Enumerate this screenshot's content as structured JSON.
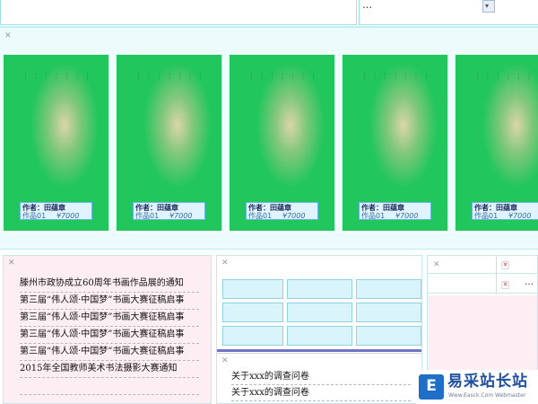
{
  "top": {
    "notice_text": "…",
    "scroll_icon": "chevron-down-icon"
  },
  "gallery": {
    "close_icon": "close-icon",
    "cards": [
      {
        "author": "作者：田蕴章",
        "work": "作品01",
        "price": "¥7000",
        "calligraphy": [
          "…",
          "…",
          "…",
          "…",
          "…",
          "…",
          "…"
        ]
      },
      {
        "author": "作者：田蕴章",
        "work": "作品01",
        "price": "¥7000",
        "calligraphy": [
          "…",
          "…",
          "…",
          "…",
          "…",
          "…",
          "…"
        ]
      },
      {
        "author": "作者：田蕴章",
        "work": "作品01",
        "price": "¥7000",
        "calligraphy": [
          "…",
          "…",
          "…",
          "…",
          "…",
          "…",
          "…"
        ]
      },
      {
        "author": "作者：田蕴章",
        "work": "作品01",
        "price": "¥7000",
        "calligraphy": [
          "…",
          "…",
          "…",
          "…",
          "…",
          "…",
          "…"
        ]
      },
      {
        "author": "作者：田蕴章",
        "work": "作品01",
        "price": "¥7000",
        "calligraphy": [
          "…",
          "…",
          "…",
          "…",
          "…",
          "…",
          "…"
        ]
      }
    ]
  },
  "news": {
    "items": [
      "滕州市政协成立60周年书画作品展的通知",
      "第三届“伟人颂·中国梦”书画大赛征稿启事",
      "第三届“伟人颂·中国梦”书画大赛征稿启事",
      "第三届“伟人颂·中国梦”书画大赛征稿启事",
      "第三届“伟人颂·中国梦”书画大赛征稿启事",
      "2015年全国教师美术书法摄影大赛通知"
    ]
  },
  "survey": {
    "items": [
      "关于xxx的调查问卷",
      "关于xxx的调查问卷"
    ]
  },
  "right_panel": {
    "cut_text": "…"
  },
  "watermark": {
    "title": "易采站长站",
    "subtitle": "Www.Easck.Com  Webmaster",
    "logo_glyph": "E"
  },
  "colors": {
    "card_green": "#21c65c",
    "gallery_bg": "#ecfbfb",
    "panel_pink": "#fdeef4",
    "grid_cell": "#d9f5fb",
    "separator_purple": "#6f74c9",
    "watermark_blue": "#1f6fc8"
  }
}
